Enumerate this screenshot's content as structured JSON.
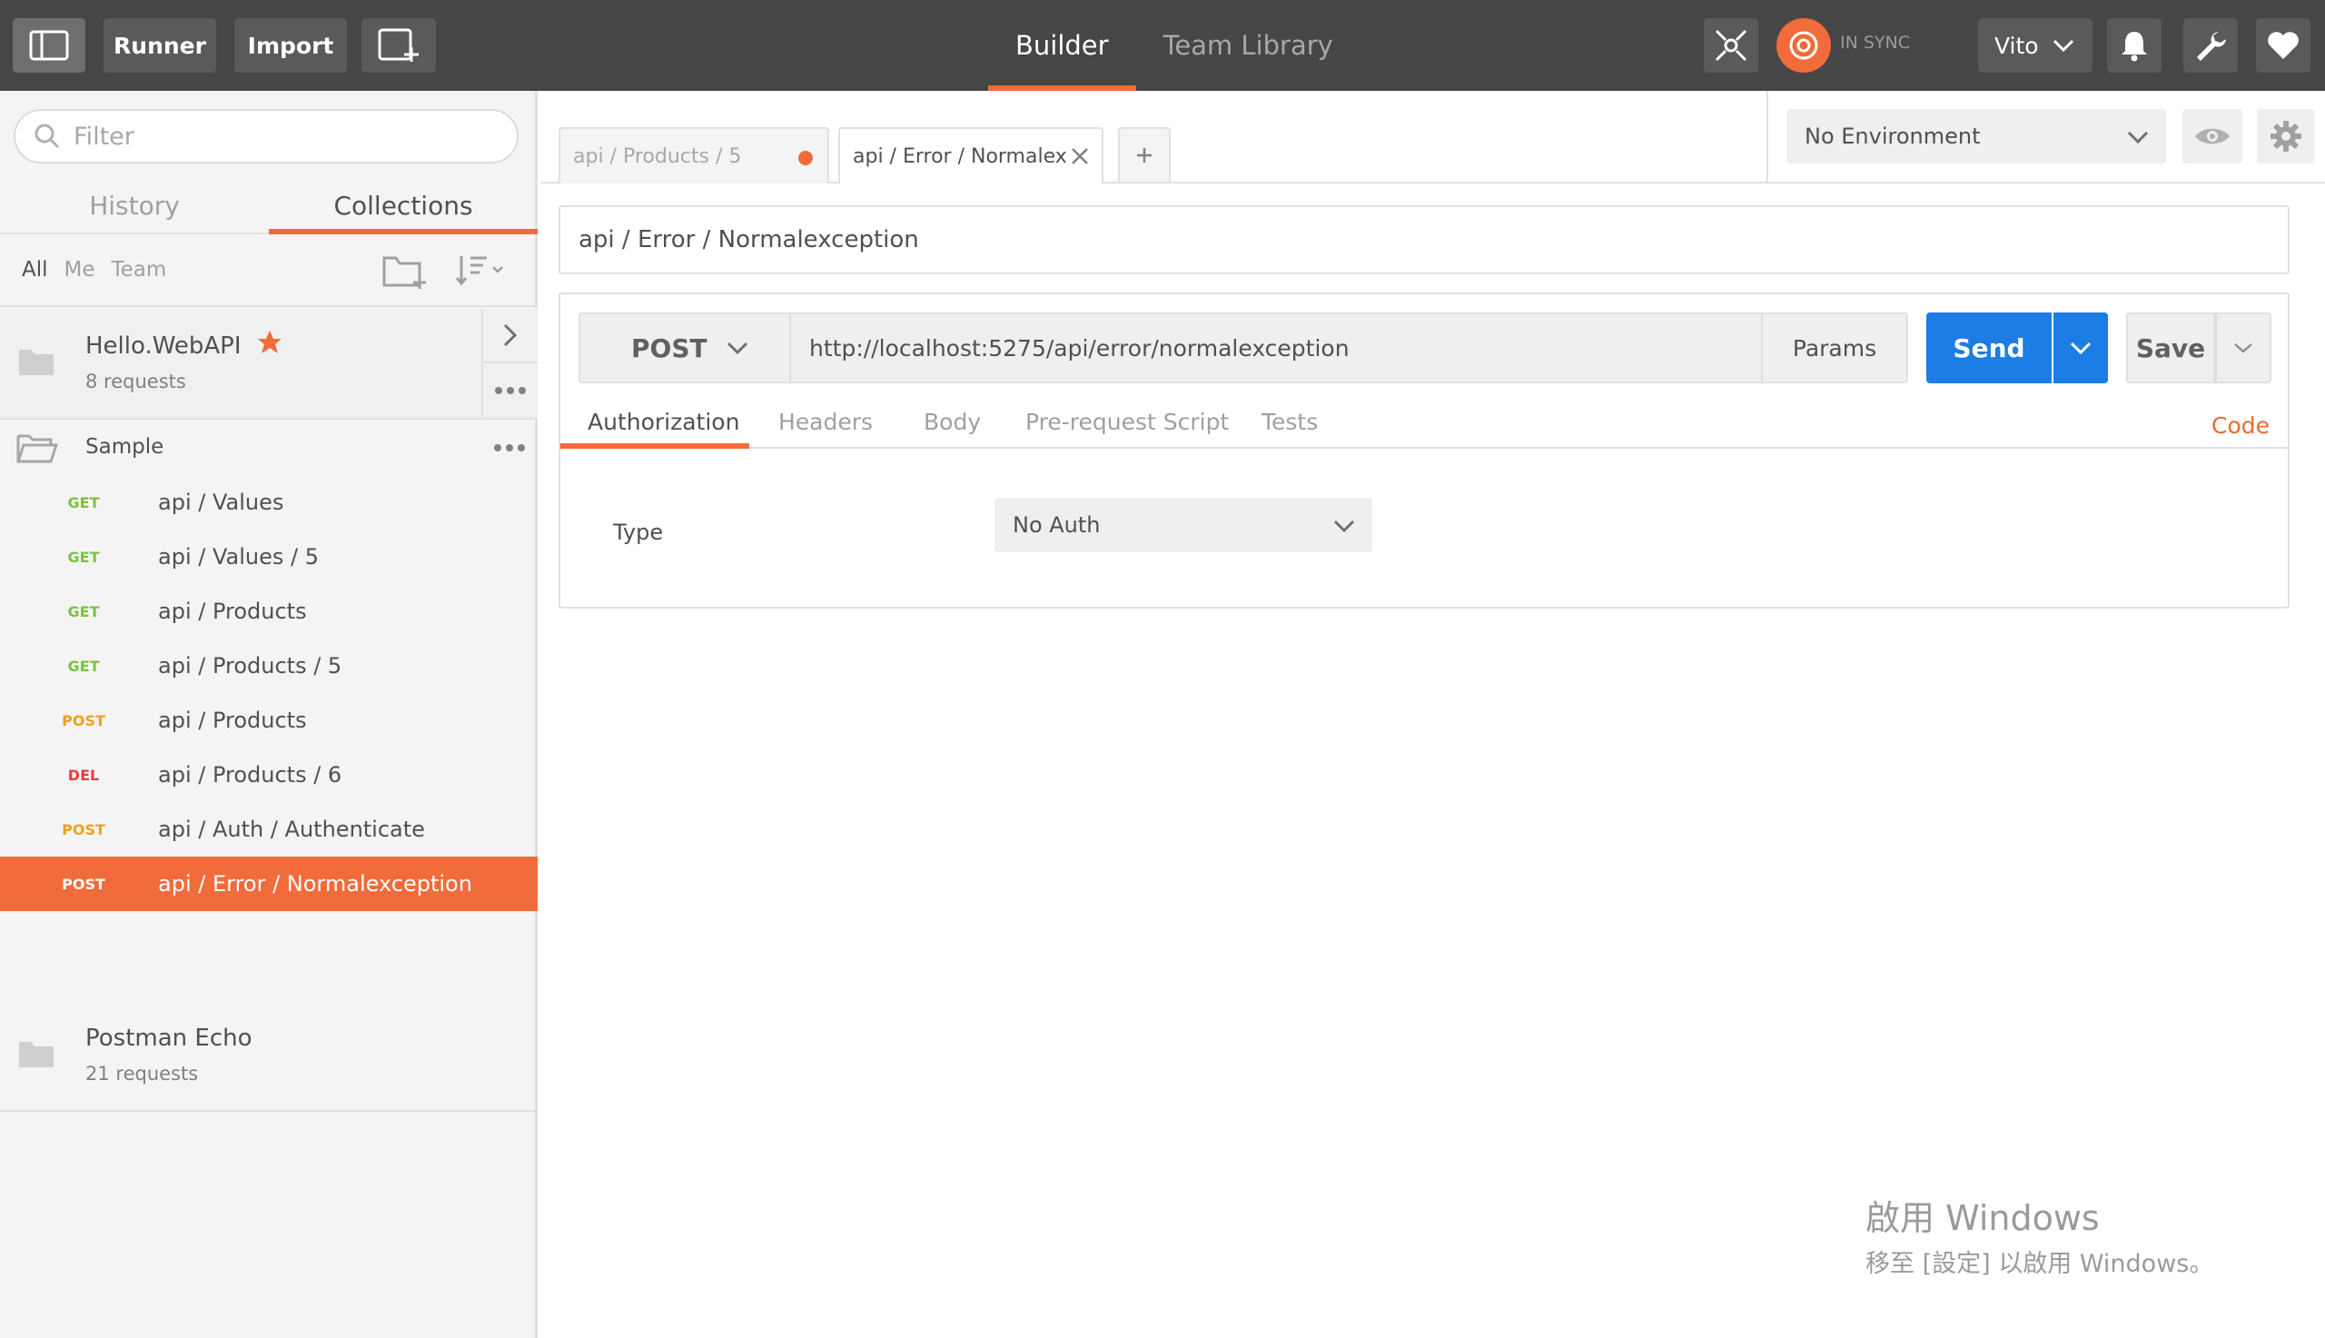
{
  "topbar": {
    "runner_label": "Runner",
    "import_label": "Import",
    "center_tabs": [
      {
        "label": "Builder",
        "active": true
      },
      {
        "label": "Team Library",
        "active": false
      }
    ],
    "sync_status": "IN SYNC",
    "user_name": "Vito",
    "accent_color": "#f26b3a"
  },
  "sidebar": {
    "filter_placeholder": "Filter",
    "tabs": [
      {
        "label": "History",
        "active": false
      },
      {
        "label": "Collections",
        "active": true
      }
    ],
    "filters": [
      "All",
      "Me",
      "Team"
    ],
    "collections": [
      {
        "name": "Hello.WebAPI",
        "count": "8 requests",
        "starred": true
      },
      {
        "name": "Postman Echo",
        "count": "21 requests",
        "starred": false
      }
    ],
    "folder": {
      "name": "Sample",
      "requests": [
        {
          "method": "GET",
          "name": "api / Values"
        },
        {
          "method": "GET",
          "name": "api / Values / 5"
        },
        {
          "method": "GET",
          "name": "api / Products"
        },
        {
          "method": "GET",
          "name": "api / Products / 5"
        },
        {
          "method": "POST",
          "name": "api / Products"
        },
        {
          "method": "DEL",
          "name": "api / Products / 6"
        },
        {
          "method": "POST",
          "name": "api / Auth / Authenticate"
        },
        {
          "method": "POST",
          "name": "api / Error / Normalexception",
          "active": true
        }
      ]
    }
  },
  "main": {
    "tabs": [
      {
        "label": "api / Products / 5",
        "unsaved": true
      },
      {
        "label": "api / Error / Normalex",
        "active": true
      }
    ],
    "environment": "No Environment",
    "request_title": "api / Error / Normalexception",
    "method": "POST",
    "url": "http://localhost:5275/api/error/normalexception",
    "params_label": "Params",
    "send_label": "Send",
    "save_label": "Save",
    "send_color": "#1c7de4",
    "sub_tabs": [
      "Authorization",
      "Headers",
      "Body",
      "Pre-request Script",
      "Tests"
    ],
    "code_label": "Code",
    "auth": {
      "type_label": "Type",
      "selected": "No Auth"
    }
  },
  "watermark": {
    "title": "啟用 Windows",
    "subtitle": "移至 [設定] 以啟用 Windows。"
  }
}
